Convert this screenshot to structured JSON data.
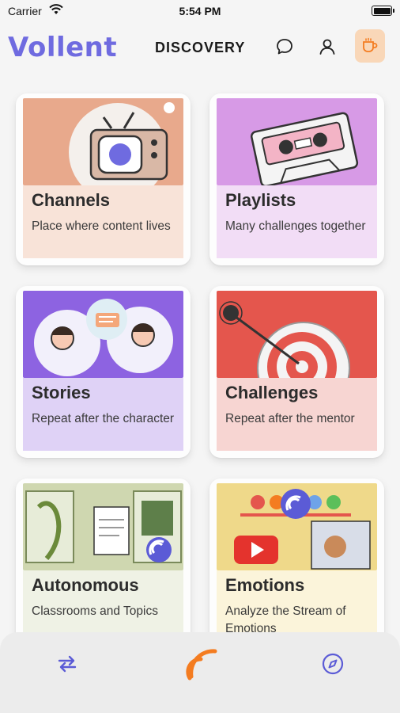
{
  "status_bar": {
    "carrier": "Carrier",
    "time": "5:54 PM"
  },
  "header": {
    "logo": "Vollent",
    "title": "DISCOVERY"
  },
  "icons": {
    "chat": "chat-bubble-icon",
    "profile": "user-icon",
    "coffee": "coffee-cup-icon",
    "swap": "swap-arrows-icon",
    "broadcast": "broadcast-waves-icon",
    "compass": "compass-icon"
  },
  "colors": {
    "accent": "#6f6be0",
    "orange": "#f47c20",
    "coffee_bg": "#f9d7b8",
    "nav_bg": "#ececec"
  },
  "cards": [
    {
      "title": "Channels",
      "subtitle": "Place where content lives",
      "art_color": "#e8a98c",
      "lower_color": "#f8e2d6"
    },
    {
      "title": "Playlists",
      "subtitle": "Many challenges together",
      "art_color": "#d79ae6",
      "lower_color": "#f1dbf5"
    },
    {
      "title": "Stories",
      "subtitle": "Repeat after the character",
      "art_color": "#8d63e1",
      "lower_color": "#ddd0f6"
    },
    {
      "title": "Challenges",
      "subtitle": "Repeat after the mentor",
      "art_color": "#e4564d",
      "lower_color": "#f7d3d0"
    },
    {
      "title": "Autonomous",
      "subtitle": "Classrooms and Topics",
      "art_color": "#cfd7b0",
      "lower_color": "#eef1e4"
    },
    {
      "title": "Emotions",
      "subtitle": "Analyze the Stream of Emotions",
      "art_color": "#efd98a",
      "lower_color": "#fbf3d8"
    }
  ]
}
